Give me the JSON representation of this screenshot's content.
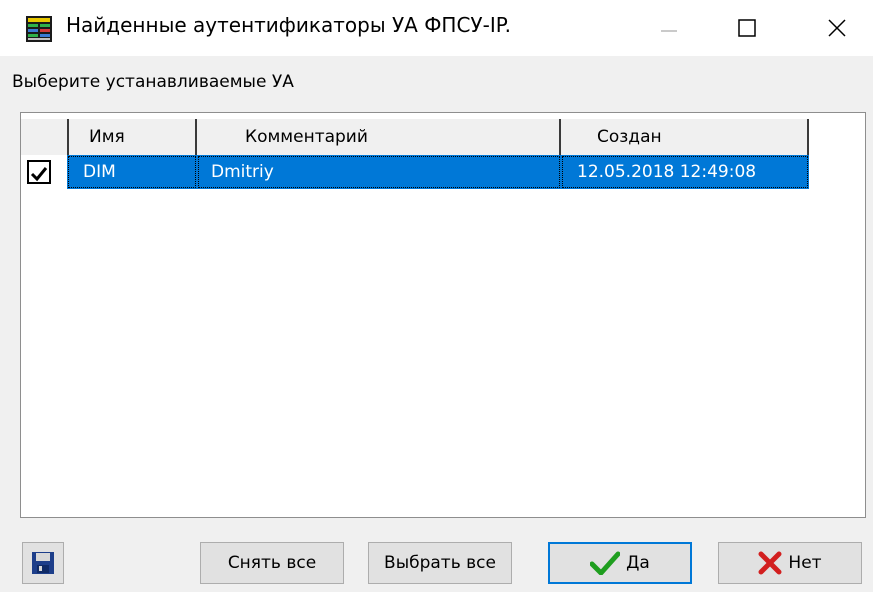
{
  "window": {
    "title": "Найденные аутентификаторы УА ФПСУ-IP.",
    "icon": "app-list-icon"
  },
  "prompt": "Выберите устанавливаемые УА",
  "table": {
    "columns": [
      "Имя",
      "Комментарий",
      "Создан"
    ],
    "rows": [
      {
        "checked": true,
        "name": "DIM",
        "comment": "Dmitriy",
        "created": "12.05.2018 12:49:08"
      }
    ]
  },
  "buttons": {
    "save_icon": "floppy-disk-icon",
    "clear_all": "Снять все",
    "select_all": "Выбрать все",
    "yes": "Да",
    "no": "Нет"
  },
  "colors": {
    "selection": "#0078d7",
    "yes_check": "#1f9e1f",
    "no_cross": "#d21f1f"
  }
}
